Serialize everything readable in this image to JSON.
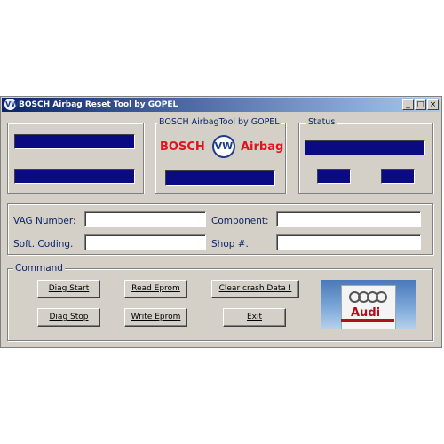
{
  "window": {
    "title": "BOSCH Airbag Reset Tool by GOPEL",
    "buttons": {
      "minimize": "_",
      "maximize": "□",
      "close": "×"
    }
  },
  "groups": {
    "aibag_tool_title": "BOSCH AirbagTool by GOPEL",
    "status_title": "Status",
    "command_title": "Command"
  },
  "brand": {
    "bosch": "BOSCH",
    "vw": "VW",
    "airbag": "Airbag",
    "audi": "Audi"
  },
  "fields": {
    "vag_number_label": "VAG Number:",
    "component_label": "Component:",
    "soft_coding_label": "Soft. Coding.",
    "shop_label": "Shop #.",
    "vag_number": "",
    "component": "",
    "soft_coding": "",
    "shop": ""
  },
  "commands": {
    "diag_start": "Diag Start",
    "read_eprom": "Read Eprom",
    "clear_crash": "Clear crash Data !",
    "diag_stop": "Diag Stop",
    "write_eprom": "Write Eprom",
    "exit": "Exit"
  },
  "colors": {
    "accent": "#0a0a82",
    "brand_red": "#e0141e",
    "label_blue": "#0a246a"
  },
  "icons": {
    "app": "vw-logo-icon"
  }
}
